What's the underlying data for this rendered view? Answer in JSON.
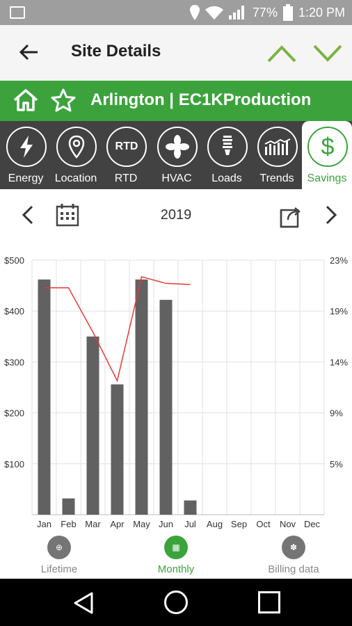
{
  "status": {
    "battery": "77%",
    "time": "1:20 PM"
  },
  "appbar": {
    "title": "Site Details"
  },
  "site": {
    "name": "Arlington | EC1KProduction"
  },
  "tabs": [
    {
      "label": "Energy",
      "icon": "lightning-icon"
    },
    {
      "label": "Location",
      "icon": "location-pin-icon"
    },
    {
      "label": "RTD",
      "icon": "rtd-icon",
      "glyph": "RTD"
    },
    {
      "label": "HVAC",
      "icon": "fan-icon"
    },
    {
      "label": "Loads",
      "icon": "bulb-icon"
    },
    {
      "label": "Trends",
      "icon": "trends-icon"
    },
    {
      "label": "Savings",
      "icon": "dollar-icon",
      "glyph": "$"
    }
  ],
  "datebar": {
    "year": "2019"
  },
  "bottom_tabs": [
    {
      "label": "Lifetime"
    },
    {
      "label": "Monthly"
    },
    {
      "label": "Billing data"
    }
  ],
  "colors": {
    "green": "#3ca33c",
    "bar": "#616161",
    "line": "#e53935"
  },
  "chart_data": {
    "type": "bar",
    "categories": [
      "Jan",
      "Feb",
      "Mar",
      "Apr",
      "May",
      "Jun",
      "Jul",
      "Aug",
      "Sep",
      "Oct",
      "Nov",
      "Dec"
    ],
    "series": [
      {
        "type": "bar",
        "axis": "left",
        "values": [
          462,
          32,
          350,
          256,
          462,
          422,
          28,
          null,
          null,
          null,
          null,
          null
        ]
      },
      {
        "type": "line",
        "axis": "right",
        "values": [
          20.5,
          20.5,
          16.5,
          12.1,
          21.5,
          20.9,
          20.8,
          null,
          null,
          null,
          null,
          null
        ]
      }
    ],
    "ylim_left": [
      0,
      500
    ],
    "ylim_right": [
      0,
      23
    ],
    "yticks_left": [
      "$100",
      "$200",
      "$300",
      "$400",
      "$500"
    ],
    "yticks_right": [
      "5%",
      "9%",
      "14%",
      "19%",
      "23%"
    ],
    "grid": true
  }
}
